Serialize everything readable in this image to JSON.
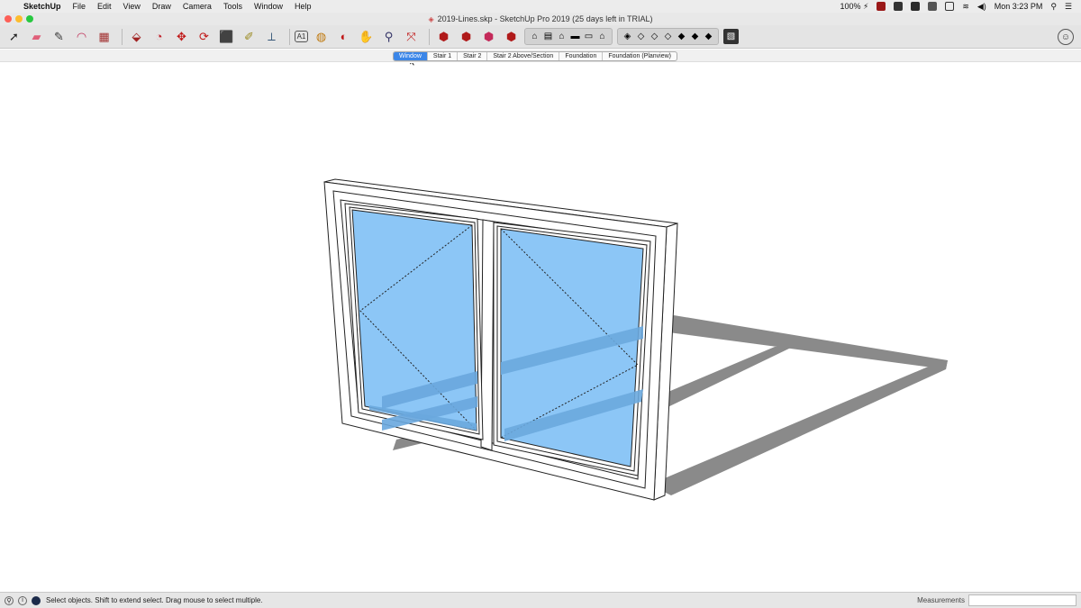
{
  "menubar": {
    "app_name": "SketchUp",
    "items": [
      "File",
      "Edit",
      "View",
      "Draw",
      "Camera",
      "Tools",
      "Window",
      "Help"
    ],
    "battery": "100% ⚡",
    "clock": "Mon 3:23 PM"
  },
  "window": {
    "title": "2019-Lines.skp - SketchUp Pro 2019 (25 days left in TRIAL)"
  },
  "toolbar": {
    "tools": [
      {
        "name": "select-tool",
        "glyph": "➚",
        "color": "#222222"
      },
      {
        "name": "eraser-tool",
        "glyph": "▰",
        "color": "#e0607a"
      },
      {
        "name": "line-tool",
        "glyph": "✎",
        "color": "#333333"
      },
      {
        "name": "arc-tool",
        "glyph": "◠",
        "color": "#c0335a"
      },
      {
        "name": "rectangle-tool",
        "glyph": "▦",
        "color": "#a13030"
      },
      {
        "name": "push-pull-tool",
        "glyph": "⬙",
        "color": "#a02222"
      },
      {
        "name": "offset-tool",
        "glyph": "◔",
        "color": "#c0202a"
      },
      {
        "name": "move-tool",
        "glyph": "✥",
        "color": "#c01818"
      },
      {
        "name": "rotate-tool",
        "glyph": "⟳",
        "color": "#c01818"
      },
      {
        "name": "scale-tool",
        "glyph": "⬛",
        "color": "#b03030"
      },
      {
        "name": "tape-measure-tool",
        "glyph": "✐",
        "color": "#9a8a20"
      },
      {
        "name": "dimension-tool",
        "glyph": "⟂",
        "color": "#335577"
      },
      {
        "name": "text-tool",
        "glyph": "A1",
        "color": "#333333"
      },
      {
        "name": "paint-bucket-tool",
        "glyph": "◍",
        "color": "#c07a10"
      },
      {
        "name": "orbit-tool",
        "glyph": "◐",
        "color": "#c01818"
      },
      {
        "name": "pan-tool",
        "glyph": "✋",
        "color": "#c99a30"
      },
      {
        "name": "zoom-tool",
        "glyph": "⚲",
        "color": "#333366"
      },
      {
        "name": "zoom-extents-tool",
        "glyph": "⤧",
        "color": "#c01818"
      },
      {
        "name": "warehouse-tool",
        "glyph": "⬢",
        "color": "#b01a1a"
      },
      {
        "name": "share-model-tool",
        "glyph": "⬢",
        "color": "#b01a1a"
      },
      {
        "name": "extension-warehouse-tool",
        "glyph": "⬢",
        "color": "#c42a5a"
      },
      {
        "name": "send-to-layout-tool",
        "glyph": "⬢",
        "color": "#b01a1a"
      }
    ],
    "views": [
      "iso-view",
      "top-view",
      "front-view",
      "right-view",
      "back-view",
      "left-view"
    ],
    "view_glyphs": [
      "⌂",
      "▤",
      "⌂",
      "▬",
      "▭",
      "⌂"
    ],
    "styles": [
      "xray-style",
      "back-edges-style",
      "wireframe-style",
      "hidden-line-style",
      "shaded-style",
      "shaded-textures-style",
      "monochrome-style"
    ],
    "style_glyphs": [
      "◈",
      "◇",
      "◇",
      "◇",
      "◆",
      "◆",
      "◆"
    ]
  },
  "scene_tabs": [
    {
      "label": "Window",
      "active": true
    },
    {
      "label": "Stair 1",
      "active": false
    },
    {
      "label": "Stair 2",
      "active": false
    },
    {
      "label": "Stair 2 Above/Section",
      "active": false
    },
    {
      "label": "Foundation",
      "active": false
    },
    {
      "label": "Foundation (Planview)",
      "active": false
    }
  ],
  "statusbar": {
    "text": "Select objects. Shift to extend select. Drag mouse to select multiple.",
    "measurements_label": "Measurements",
    "measurements_value": ""
  },
  "colors": {
    "glass": "#8cc6f6",
    "frame": "#ffffff",
    "shadow": "#8a8a8a",
    "accent": "#3b86e8"
  }
}
